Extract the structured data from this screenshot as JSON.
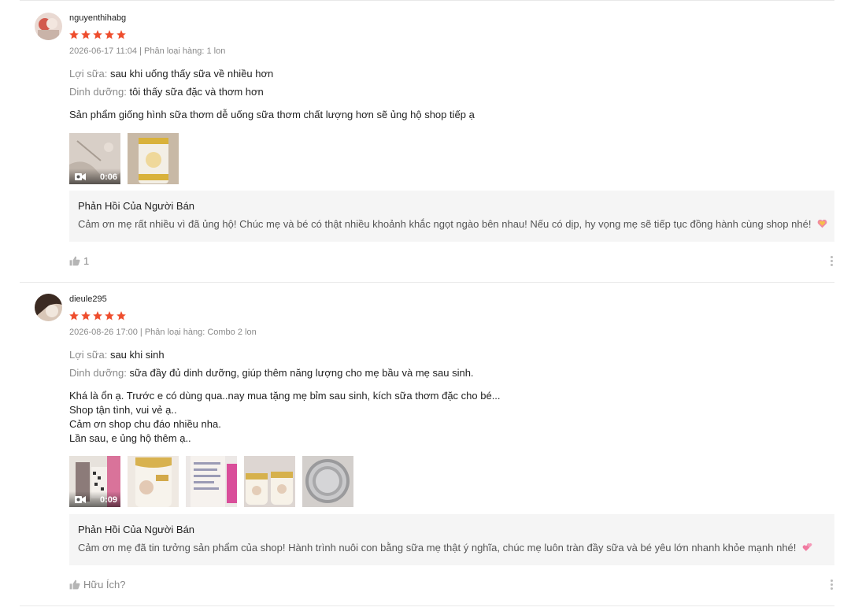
{
  "reviews": [
    {
      "username": "nguyenthihabg",
      "rating": 5,
      "meta": "2026-06-17 11:04 | Phân loại hàng: 1 lon",
      "attr1_label": "Lợi sữa:",
      "attr1_value": "sau khi uống thấy sữa về nhiều hơn",
      "attr2_label": "Dinh dưỡng:",
      "attr2_value": "tôi thấy sữa đặc và thơm hơn",
      "content": [
        "Sản phẩm giống hình sữa thơm dễ uống sữa thơm chất lượng hơn sẽ ủng hộ shop tiếp ạ"
      ],
      "video_duration": "0:06",
      "reply_title": "Phản Hồi Của Người Bán",
      "reply_text": "Cảm ơn mẹ rất nhiều vì đã ủng hộ! Chúc mẹ và bé có thật nhiều khoảnh khắc ngọt ngào bên nhau! Nếu có dịp, hy vọng mẹ sẽ tiếp tục đồng hành cùng shop nhé!",
      "like_text": "1"
    },
    {
      "username": "dieule295",
      "rating": 5,
      "meta": "2026-08-26 17:00 | Phân loại hàng: Combo 2 lon",
      "attr1_label": "Lợi sữa:",
      "attr1_value": "sau khi sinh",
      "attr2_label": "Dinh dưỡng:",
      "attr2_value": "sữa đầy đủ dinh dưỡng, giúp thêm năng lượng cho mẹ bầu và mẹ sau sinh.",
      "content": [
        "Khá là ổn ạ. Trước e có dùng qua..nay mua tặng mẹ bỉm sau sinh, kích sữa thơm đặc cho bé...",
        "Shop tận tình, vui vẻ ạ..",
        "Cảm ơn shop chu đáo nhiều nha.",
        "Lần sau, e ủng hộ thêm ạ.."
      ],
      "video_duration": "0:09",
      "reply_title": "Phản Hồi Của Người Bán",
      "reply_text": "Cảm ơn mẹ đã tin tưởng sản phẩm của shop! Hành trình nuôi con bằng sữa mẹ thật ý nghĩa, chúc mẹ luôn tràn đầy sữa và bé yêu lớn nhanh khỏe mạnh nhé!",
      "like_text": "Hữu Ích?"
    }
  ],
  "colors": {
    "star": "#ee4d2d",
    "reply_bg": "#f5f5f5",
    "muted": "#8a8a8a"
  }
}
